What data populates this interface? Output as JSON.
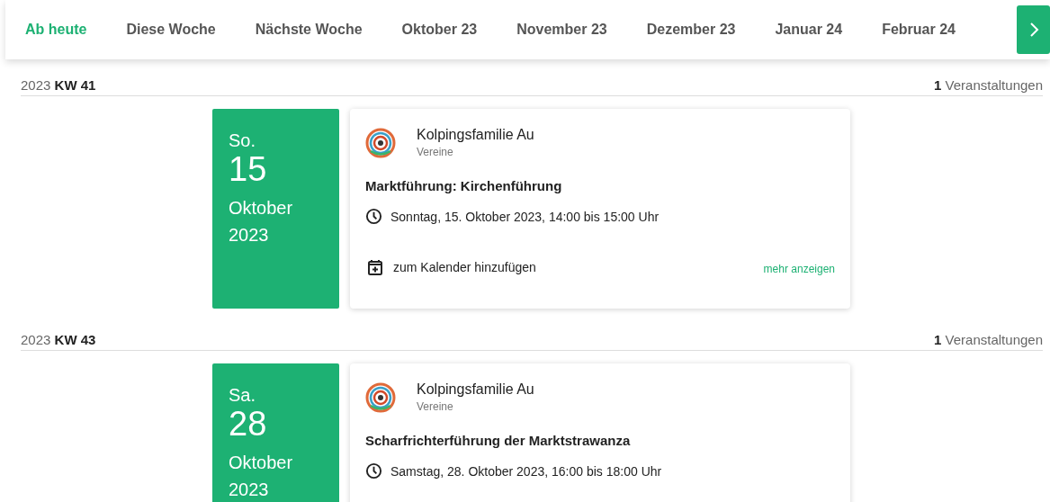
{
  "tabs": [
    {
      "label": "Ab heute",
      "selected": true
    },
    {
      "label": "Diese Woche",
      "selected": false
    },
    {
      "label": "Nächste Woche",
      "selected": false
    },
    {
      "label": "Oktober 23",
      "selected": false
    },
    {
      "label": "November 23",
      "selected": false
    },
    {
      "label": "Dezember 23",
      "selected": false
    },
    {
      "label": "Januar 24",
      "selected": false
    },
    {
      "label": "Februar 24",
      "selected": false
    }
  ],
  "weeks": [
    {
      "year": "2023",
      "week": "KW 41",
      "count": "1",
      "count_label": "Veranstaltungen",
      "events": [
        {
          "weekday": "So.",
          "day": "15",
          "month": "Oktober",
          "year": "2023",
          "organizer": "Kolpingsfamilie Au",
          "category": "Vereine",
          "title": "Marktführung: Kirchenführung",
          "time": "Sonntag, 15. Oktober 2023, 14:00 bis 15:00 Uhr",
          "calendar_link": "zum Kalender hinzufügen",
          "more_link": "mehr anzeigen"
        }
      ]
    },
    {
      "year": "2023",
      "week": "KW 43",
      "count": "1",
      "count_label": "Veranstaltungen",
      "events": [
        {
          "weekday": "Sa.",
          "day": "28",
          "month": "Oktober",
          "year": "2023",
          "organizer": "Kolpingsfamilie Au",
          "category": "Vereine",
          "title": "Scharfrichterführung der Marktstrawanza",
          "time": "Samstag, 28. Oktober 2023, 16:00 bis 18:00 Uhr"
        }
      ]
    }
  ]
}
